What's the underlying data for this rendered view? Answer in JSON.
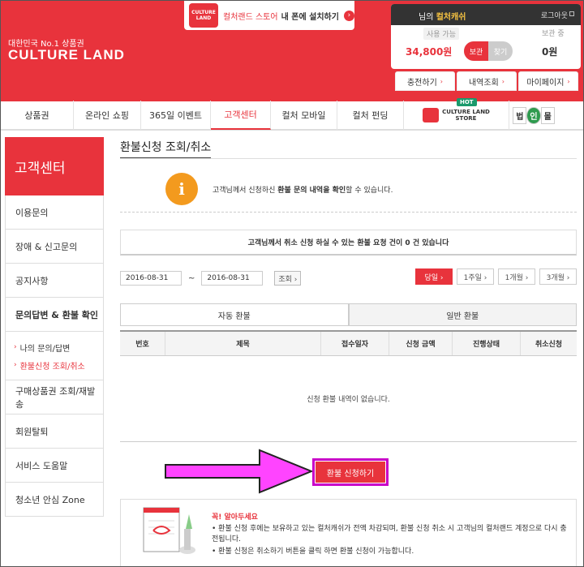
{
  "header": {
    "brand_small": "대한민국 No.1 상품권",
    "brand_big": "CULTURE LAND",
    "app_logo": "CULTURE LAND",
    "app_banner_text1": "컬처랜드 스토어",
    "app_banner_text2": "내 폰에 설치하기",
    "user_suffix": "님의",
    "user_cash_name": "컬처캐쉬",
    "logout": "로그아웃",
    "available_label": "사용 가능",
    "keep_label": "보관 중",
    "available_amount": "34,800원",
    "keep_amount": "0원",
    "toggle_keep": "보관",
    "toggle_find": "찾기",
    "subtabs": [
      {
        "label": "충전하기"
      },
      {
        "label": "내역조회"
      },
      {
        "label": "마이페이지"
      }
    ]
  },
  "gnb": {
    "items": [
      {
        "label": "상품권",
        "w": 90
      },
      {
        "label": "온라인 쇼핑",
        "w": 83
      },
      {
        "label": "365일 이벤트",
        "w": 86
      },
      {
        "label": "고객센터",
        "w": 74
      },
      {
        "label": "컬처 모바일",
        "w": 82
      },
      {
        "label": "컬처 펀딩",
        "w": 82
      }
    ],
    "hot": "HOT",
    "store_line1": "CULTURE LAND",
    "store_line2": "STORE",
    "beob": [
      "법",
      "인",
      "몰"
    ]
  },
  "sidebar": {
    "title": "고객센터",
    "items_top": [
      "이용문의",
      "장애 & 신고문의",
      "공지사항",
      "문의답변 & 환불 확인"
    ],
    "sub_items": [
      "나의 문의/답변",
      "환불신청 조회/취소"
    ],
    "items_bottom": [
      "구매상품권 조회/재발송",
      "회원탈퇴",
      "서비스 도움말",
      "청소년 안심 Zone"
    ]
  },
  "main": {
    "title": "환불신청 조회/취소",
    "info_icon": "i",
    "notice_pre": "고객님께서 신청하신 ",
    "notice_bold": "환불 문의 내역을 확인",
    "notice_post": "할 수 있습니다.",
    "count_text": "고객님께서 취소 신청 하실 수 있는 환불 요청 건이 0 건 있습니다",
    "date_from": "2016-08-31",
    "date_to": "2016-08-31",
    "tilde": "~",
    "query_btn": "조회 ›",
    "periods": [
      "당일 ›",
      "1주일 ›",
      "1개월 ›",
      "3개월 ›"
    ],
    "tabs": [
      "자동 환불",
      "일반 환불"
    ],
    "table_headers": [
      "번호",
      "제목",
      "접수일자",
      "신청 금액",
      "진행상태",
      "취소신청"
    ],
    "empty_text": "신청 환불 내역이 없습니다.",
    "apply_button": "환불 신청하기",
    "bottom_title": "꼭! 알아두세요",
    "bottom_items": [
      "• 환불 신청 후에는 보유하고 있는 컬처캐쉬가 전액 차감되며, 환불 신청 취소 시 고객님의 컬처랜드 계정으로 다시 충전됩니다.",
      "• 환불 신청은 취소하기 버튼을 클릭 하면 환불 신청이 가능합니다."
    ]
  },
  "colors": {
    "brand_red": "#e8333c",
    "highlight_magenta": "#c800c8"
  }
}
